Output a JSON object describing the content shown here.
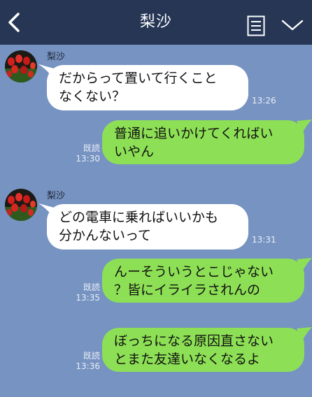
{
  "header": {
    "title": "梨沙",
    "back_icon": "chevron-left-icon",
    "notes_icon": "notes-icon",
    "menu_icon": "chevron-down-icon",
    "background": "#263654"
  },
  "chat": {
    "background": "#7693c1",
    "incoming_color": "#ffffff",
    "outgoing_color": "#8de055",
    "messages": [
      {
        "direction": "in",
        "sender": "梨沙",
        "lines": [
          "だからって置いて行くこと",
          "なくない？"
        ],
        "time": "13:26"
      },
      {
        "direction": "out",
        "lines": [
          "普通に追いかけてくればい",
          "いやん"
        ],
        "read": "既読",
        "time": "13:30"
      },
      {
        "direction": "in",
        "sender": "梨沙",
        "lines": [
          "どの電車に乗ればいいかも",
          "分かんないって"
        ],
        "time": "13:31"
      },
      {
        "direction": "out",
        "lines": [
          "んーそういうとこじゃない",
          "？皆にイライラされんの"
        ],
        "read": "既読",
        "time": "13:35"
      },
      {
        "direction": "out",
        "lines": [
          "ぼっちになる原因直さない",
          "とまた友達いなくなるよ"
        ],
        "read": "既読",
        "time": "13:36"
      }
    ]
  }
}
